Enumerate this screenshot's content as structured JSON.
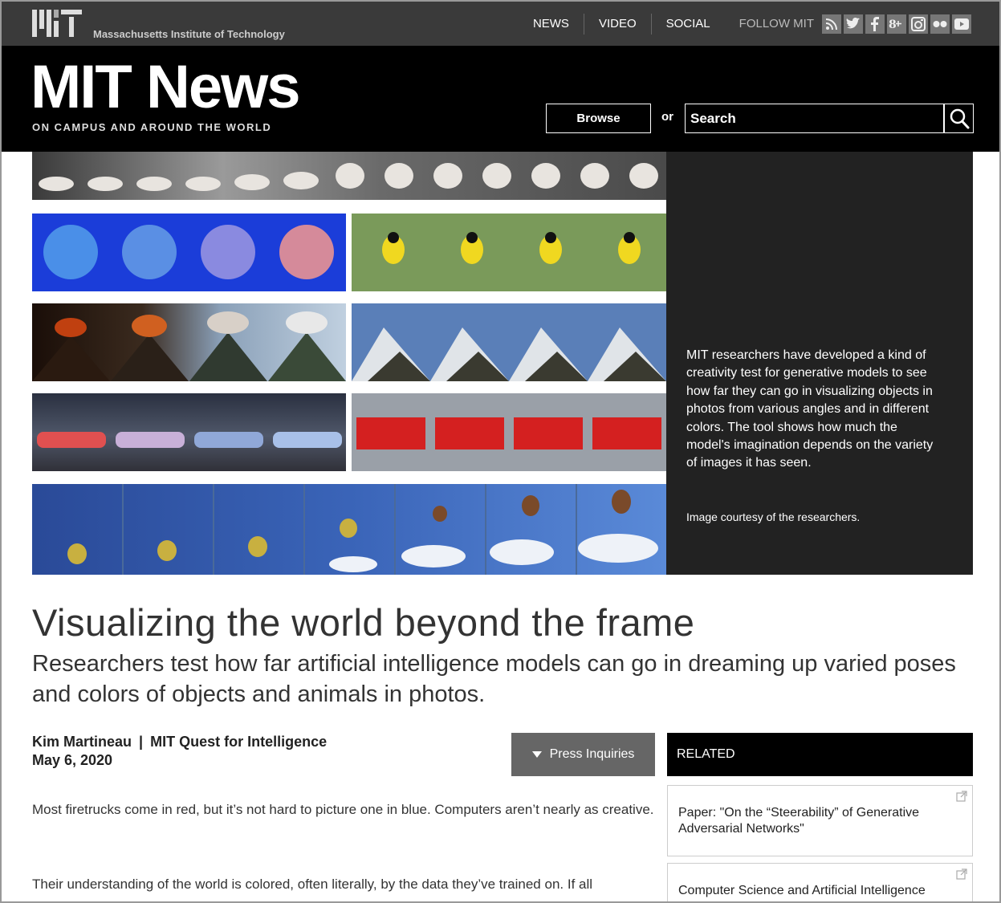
{
  "topbar": {
    "institution": "Massachusetts Institute of Technology",
    "nav": [
      "NEWS",
      "VIDEO",
      "SOCIAL"
    ],
    "follow_label": "FOLLOW MIT",
    "social_icons": [
      "rss-icon",
      "twitter-icon",
      "facebook-icon",
      "google-plus-icon",
      "instagram-icon",
      "flickr-icon",
      "youtube-icon"
    ]
  },
  "header": {
    "brand": "MIT News",
    "tagline": "ON CAMPUS AND AROUND THE WORLD",
    "browse_label": "Browse",
    "or_label": "or",
    "search_placeholder": "Search"
  },
  "hero": {
    "caption": "MIT researchers have developed a kind of creativity test for generative models to see how far they can go in visualizing objects in photos from various angles and in different colors. The tool shows how much the model's imagination depends on the variety of images it has seen.",
    "credit": "Image courtesy of the researchers."
  },
  "article": {
    "title": "Visualizing the world beyond the frame",
    "subtitle": "Researchers test how far artificial intelligence models can go in dreaming up varied poses and colors of objects and animals in photos.",
    "author": "Kim Martineau",
    "separator": "|",
    "department": "MIT Quest for Intelligence",
    "date": "May 6, 2020",
    "press_label": "Press Inquiries",
    "paragraphs": [
      "Most firetrucks come in red, but it’s not hard to picture one in blue. Computers aren’t nearly as creative.",
      "Their understanding of the world is colored, often literally, by the data they’ve trained on. If all"
    ]
  },
  "related": {
    "heading": "RELATED",
    "items": [
      "Paper: \"On the “Steerability” of Generative Adversarial Networks\"",
      "Computer Science and Artificial Intelligence"
    ]
  },
  "colors": {
    "topbar_bg": "#3a3a3a",
    "header_bg": "#000000",
    "caption_bg": "#222222",
    "press_bg": "#666666"
  }
}
